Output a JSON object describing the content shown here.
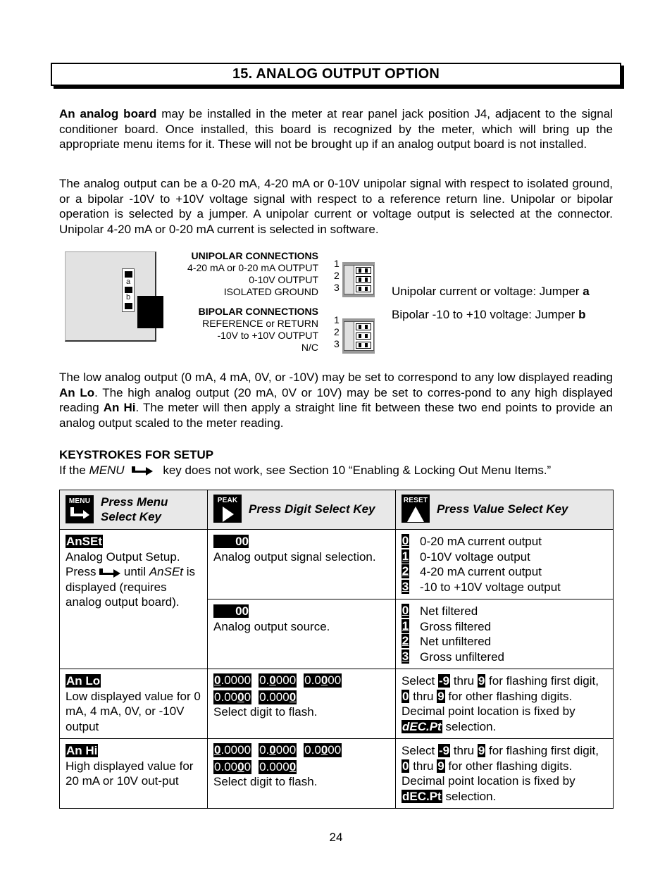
{
  "section": {
    "title": "15.  ANALOG OUTPUT OPTION"
  },
  "paragraphs": {
    "p1_bold": "An analog board",
    "p1_rest": " may be installed in the meter at rear panel jack position J4, adjacent to the signal conditioner board. Once installed, this board is recognized by the meter, which will bring up the appropriate menu items for it. These will not be brought up if an analog output board is not installed.",
    "p2": "The analog output can be a 0-20 mA, 4-20 mA or 0-10V unipolar signal with respect to isolated ground, or a bipolar -10V to +10V voltage signal with respect to a reference return line. Unipolar or bipolar operation is selected by a jumper. A unipolar current or voltage output is selected at the connector.  Unipolar 4-20 mA or 0-20 mA current is selected in software.",
    "p3_a": "The low analog output (0 mA, 4 mA, 0V, or -10V) may be set to correspond to any low displayed reading ",
    "p3_b": "An Lo",
    "p3_c": ". The high analog output (20 mA, 0V or 10V) may be set to corres-pond to any high displayed reading ",
    "p3_d": "An Hi",
    "p3_e": ". The meter will then apply a straight line fit between these two end points to provide an analog output scaled to the meter reading."
  },
  "diagram": {
    "jumper_labels": [
      "a",
      "b"
    ],
    "unipolar": {
      "heading": "UNIPOLAR CONNECTIONS",
      "pins": [
        "4-20 mA or 0-20 mA OUTPUT",
        "0-10V OUTPUT",
        "ISOLATED GROUND"
      ]
    },
    "bipolar": {
      "heading": "BIPOLAR CONNECTIONS",
      "pins": [
        "REFERENCE or RETURN",
        "-10V to +10V OUTPUT",
        "N/C"
      ]
    },
    "pin_numbers": [
      "1",
      "2",
      "3"
    ],
    "notes": {
      "unipolar_text": "Unipolar current or voltage: Jumper ",
      "unipolar_jumper": "a",
      "bipolar_text": "Bipolar -10 to +10 voltage: Jumper ",
      "bipolar_jumper": "b"
    }
  },
  "keystrokes": {
    "heading": "KEYSTROKES FOR SETUP",
    "line_a": "If the ",
    "line_menu": "MENU",
    "line_b": " key does not work, see Section 10 “Enabling & Locking Out Menu Items.”",
    "icon": "right-arrow-icon"
  },
  "table": {
    "headers": [
      {
        "key": "MENU",
        "icon": "menu-arrow-icon",
        "label": "Press Menu Select Key"
      },
      {
        "key": "PEAK",
        "icon": "play-triangle-icon",
        "label": "Press Digit Select Key"
      },
      {
        "key": "RESET",
        "icon": "up-triangle-icon",
        "label": "Press Value Select Key"
      }
    ],
    "rows": {
      "anset": {
        "display": "AnSEt",
        "desc_a": "Analog Output Setup. Press ",
        "desc_b": " until ",
        "desc_italic": "AnSEt",
        "desc_c": " is displayed (requires analog output board).",
        "sub": [
          {
            "display": "00",
            "desc": "Analog output signal selection.",
            "options": [
              {
                "n": "0",
                "label": "0-20 mA current output"
              },
              {
                "n": "1",
                "label": "0-10V voltage output"
              },
              {
                "n": "2",
                "label": "4-20 mA current output"
              },
              {
                "n": "3",
                "label": "-10 to +10V voltage output"
              }
            ]
          },
          {
            "display": "00",
            "desc": "Analog output source.",
            "options": [
              {
                "n": "0",
                "label": "Net filtered"
              },
              {
                "n": "1",
                "label": "Gross filtered"
              },
              {
                "n": "2",
                "label": "Net unfiltered"
              },
              {
                "n": "3",
                "label": "Gross unfiltered"
              }
            ]
          }
        ]
      },
      "anlo": {
        "display": "An Lo",
        "desc": "Low displayed value for 0 mA, 4 mA, 0V, or -10V output",
        "digits": [
          "0.0000",
          "0.0000",
          "0.0000",
          "0.0000",
          "0.0000"
        ],
        "digit_note": "Select digit to flash.",
        "value_a": "Select ",
        "neg9": "-9",
        "value_b": " thru ",
        "nine": "9",
        "value_c": " for flashing first digit, ",
        "zero": "0",
        "value_d": " for other flashing digits. Decimal point location is fixed by ",
        "decpt": "dEC.Pt",
        "value_e": " selection."
      },
      "anhi": {
        "display": "An Hi",
        "desc": "High displayed value for 20 mA or 10V out-put",
        "digits": [
          "0.0000",
          "0.0000",
          "0.0000",
          "0.0000",
          "0.0000"
        ],
        "digit_note": "Select digit to flash.",
        "value_a": "Select ",
        "neg9": "-9",
        "value_b": " thru ",
        "nine": "9",
        "value_c": " for flashing first digit, ",
        "zero": "0",
        "value_d": " for other flashing digits. Decimal point location is fixed by ",
        "decpt": "dEC.Pt",
        "value_e": " selection."
      }
    }
  },
  "page_number": "24"
}
